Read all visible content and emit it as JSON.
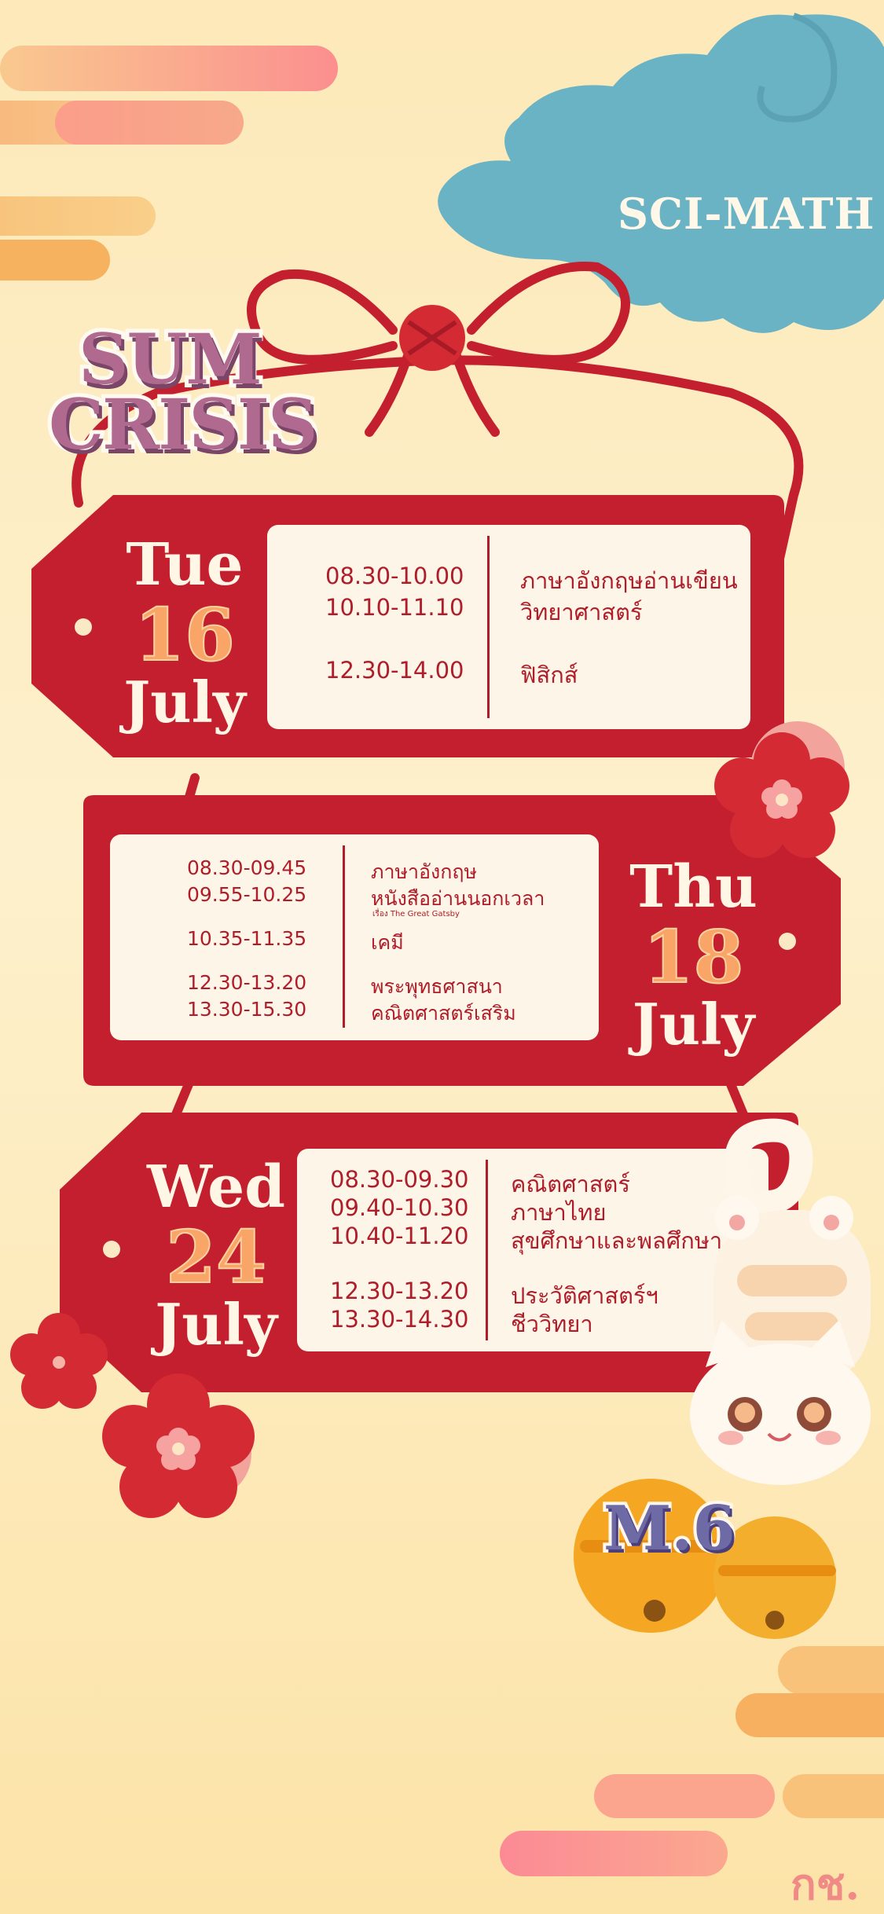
{
  "header": {
    "program": "SCI-MATH",
    "title_line1": "SUM",
    "title_line2": "CRISIS"
  },
  "days": [
    {
      "day": "Tue",
      "date": "16",
      "month": "July",
      "times": [
        "08.30-10.00",
        "10.10-11.10",
        "12.30-14.00"
      ],
      "subjects": [
        "ภาษาอังกฤษอ่านเขียน",
        "วิทยาศาสตร์",
        "ฟิสิกส์"
      ]
    },
    {
      "day": "Thu",
      "date": "18",
      "month": "July",
      "times": [
        "08.30-09.45",
        "09.55-10.25",
        "10.35-11.35",
        "12.30-13.20",
        "13.30-15.30"
      ],
      "subjects": [
        "ภาษาอังกฤษ",
        "หนังสืออ่านนอกเวลา",
        "เคมี",
        "พระพุทธศาสนา",
        "คณิตศาสตร์เสริม"
      ],
      "note": "เรื่อง The Great Gatsby"
    },
    {
      "day": "Wed",
      "date": "24",
      "month": "July",
      "times": [
        "08.30-09.30",
        "09.40-10.30",
        "10.40-11.20",
        "12.30-13.20",
        "13.30-14.30"
      ],
      "subjects": [
        "คณิตศาสตร์",
        "ภาษาไทย",
        "สุขศึกษาและพลศึกษา",
        "ประวัติศาสตร์ฯ",
        "ชีววิทยา"
      ]
    }
  ],
  "badge": "M.6",
  "signature": "กช.",
  "colors": {
    "background": "#fde9b9",
    "tag_red": "#c41f2e",
    "panel": "#fdf5e7",
    "text_red": "#b01d2a",
    "cloud_blue": "#6ab3c4",
    "flower_red": "#d42a34"
  }
}
